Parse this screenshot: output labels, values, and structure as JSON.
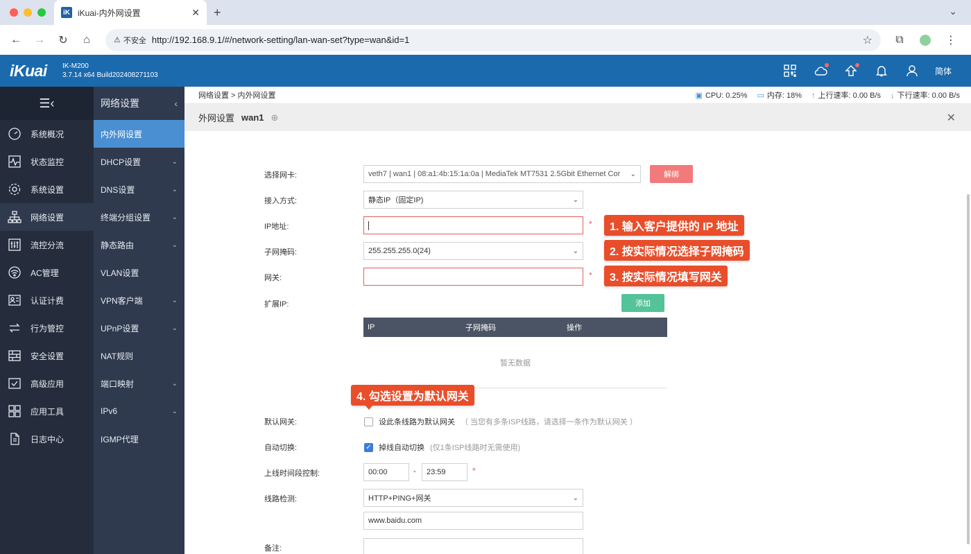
{
  "browser": {
    "tab_title": "iKuai-内外网设置",
    "tab_logo": "iK",
    "security_label": "不安全",
    "url": "http://192.168.9.1/#/network-setting/lan-wan-set?type=wan&id=1"
  },
  "header": {
    "logo": "iKuai",
    "model": "IK-M200",
    "version": "3.7.14 x64 Build202408271103",
    "lang": "简体"
  },
  "sidebar1": {
    "items": [
      {
        "label": "系统概况",
        "icon": "gauge-icon"
      },
      {
        "label": "状态监控",
        "icon": "pulse-icon"
      },
      {
        "label": "系统设置",
        "icon": "gear-icon"
      },
      {
        "label": "网络设置",
        "icon": "network-icon"
      },
      {
        "label": "流控分流",
        "icon": "sliders-icon"
      },
      {
        "label": "AC管理",
        "icon": "wifi-icon"
      },
      {
        "label": "认证计费",
        "icon": "id-card-icon"
      },
      {
        "label": "行为管控",
        "icon": "arrows-icon"
      },
      {
        "label": "安全设置",
        "icon": "firewall-icon"
      },
      {
        "label": "高级应用",
        "icon": "checkbox-icon"
      },
      {
        "label": "应用工具",
        "icon": "apps-icon"
      },
      {
        "label": "日志中心",
        "icon": "document-icon"
      }
    ]
  },
  "sidebar2": {
    "title": "网络设置",
    "items": [
      {
        "label": "内外网设置",
        "chevron": false
      },
      {
        "label": "DHCP设置",
        "chevron": true
      },
      {
        "label": "DNS设置",
        "chevron": true
      },
      {
        "label": "终端分组设置",
        "chevron": true
      },
      {
        "label": "静态路由",
        "chevron": true
      },
      {
        "label": "VLAN设置",
        "chevron": false
      },
      {
        "label": "VPN客户端",
        "chevron": true
      },
      {
        "label": "UPnP设置",
        "chevron": true
      },
      {
        "label": "NAT规则",
        "chevron": false
      },
      {
        "label": "端口映射",
        "chevron": true
      },
      {
        "label": "IPv6",
        "chevron": true
      },
      {
        "label": "IGMP代理",
        "chevron": false
      }
    ]
  },
  "breadcrumb": "网络设置 > 内外网设置",
  "stats": {
    "cpu": "CPU: 0.25%",
    "mem": "内存: 18%",
    "up": "上行速率: 0.00 B/s",
    "down": "下行速率: 0.00 B/s"
  },
  "page": {
    "title": "外网设置",
    "subtitle": "wan1"
  },
  "form": {
    "nic_label": "选择网卡:",
    "nic_value": "veth7 | wan1 | 08:a1:4b:15:1a:0a | MediaTek MT7531 2.5Gbit Ethernet Cor",
    "unbind": "解绑",
    "access_label": "接入方式:",
    "access_value": "静态IP（固定IP)",
    "ip_label": "IP地址:",
    "ip_value": "",
    "mask_label": "子网掩码:",
    "mask_value": "255.255.255.0(24)",
    "gw_label": "网关:",
    "gw_value": "",
    "ext_label": "扩展IP:",
    "add": "添加",
    "table_headers": [
      "IP",
      "子网掩码",
      "操作"
    ],
    "empty": "暂无数据",
    "default_gw_label": "默认网关:",
    "default_gw_text": "设此条线路为默认网关",
    "default_gw_hint": "（ 当您有多条ISP线路，请选择一条作为默认网关 ）",
    "auto_switch_label": "自动切换:",
    "auto_switch_text": "掉线自动切换",
    "auto_switch_hint": "(仅1条ISP线路时无需使用)",
    "time_label": "上线时间段控制:",
    "time_start": "00:00",
    "time_sep": "-",
    "time_end": "23:59",
    "detect_label": "线路检测:",
    "detect_value": "HTTP+PING+网关",
    "detect_host": "www.baidu.com",
    "remark_label": "备注:"
  },
  "callouts": {
    "c1": "1. 输入客户提供的 IP 地址",
    "c2": "2. 按实际情况选择子网掩码",
    "c3": "3. 按实际情况填写网关",
    "c4": "4. 勾选设置为默认网关"
  },
  "colors": {
    "header_blue": "#1b6aae",
    "callout_red": "#e94e2b",
    "unbind_red": "#f37a7a",
    "add_green": "#55c39a",
    "checkbox_blue": "#3b7ed4"
  }
}
